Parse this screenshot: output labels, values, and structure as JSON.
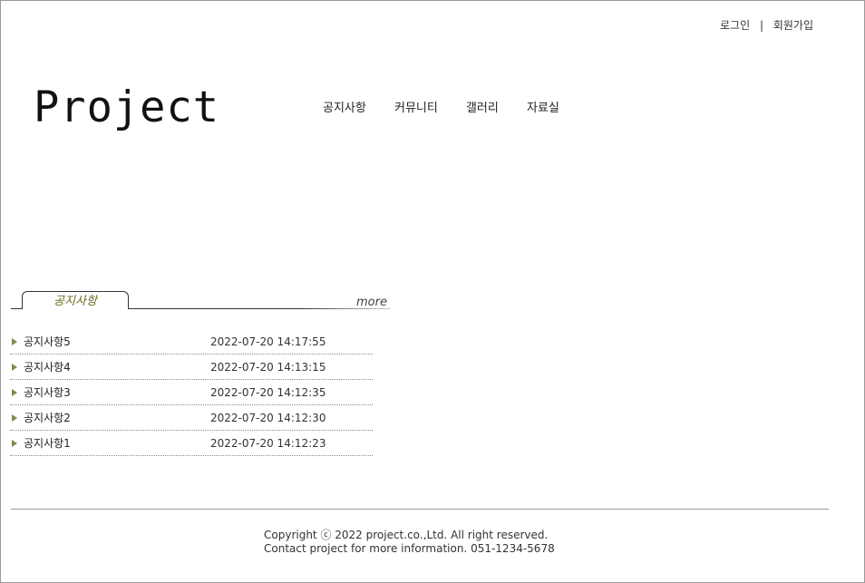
{
  "header": {
    "login": "로그인",
    "separator": "|",
    "signup": "회원가입",
    "logo": "Project"
  },
  "nav": {
    "items": [
      "공지사항",
      "커뮤니티",
      "갤러리",
      "자료실"
    ]
  },
  "notice": {
    "tab_label": "공지사항",
    "more_label": "more",
    "rows": [
      {
        "title": "공지사항5",
        "date": "2022-07-20 14:17:55"
      },
      {
        "title": "공지사항4",
        "date": "2022-07-20 14:13:15"
      },
      {
        "title": "공지사항3",
        "date": "2022-07-20 14:12:35"
      },
      {
        "title": "공지사항2",
        "date": "2022-07-20 14:12:30"
      },
      {
        "title": "공지사항1",
        "date": "2022-07-20 14:12:23"
      }
    ]
  },
  "footer": {
    "line1": "Copyright ⓒ 2022 project.co.,Ltd. All right reserved.",
    "line2": "Contact project for more information. 051-1234-5678"
  }
}
